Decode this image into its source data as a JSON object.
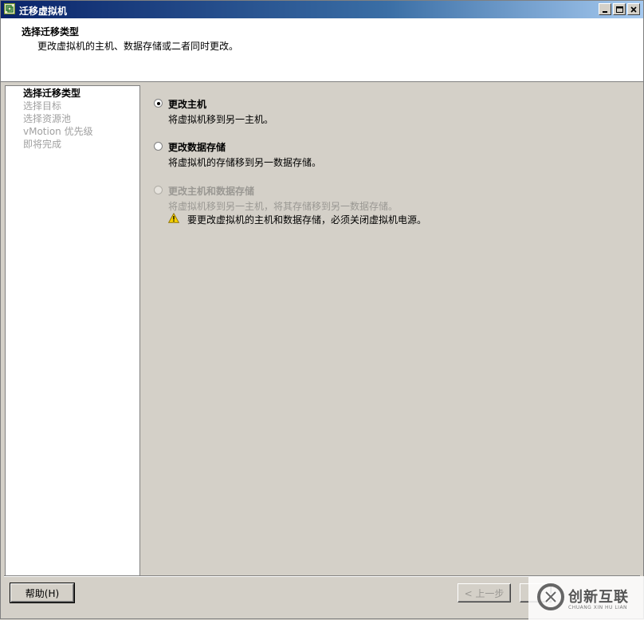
{
  "window": {
    "title": "迁移虚拟机",
    "icon": "vm-migrate-icon"
  },
  "header": {
    "title": "选择迁移类型",
    "subtitle": "更改虚拟机的主机、数据存储或二者同时更改。"
  },
  "steps": [
    {
      "label": "选择迁移类型",
      "active": true
    },
    {
      "label": "选择目标",
      "active": false
    },
    {
      "label": "选择资源池",
      "active": false
    },
    {
      "label": "vMotion 优先级",
      "active": false
    },
    {
      "label": "即将完成",
      "active": false
    }
  ],
  "options": [
    {
      "label": "更改主机",
      "desc": "将虚拟机移到另一主机。",
      "selected": true,
      "enabled": true
    },
    {
      "label": "更改数据存储",
      "desc": "将虚拟机的存储移到另一数据存储。",
      "selected": false,
      "enabled": true
    },
    {
      "label": "更改主机和数据存储",
      "desc": "将虚拟机移到另一主机，将其存储移到另一数据存储。",
      "selected": false,
      "enabled": false,
      "warning": "要更改虚拟机的主机和数据存储，必须关闭虚拟机电源。"
    }
  ],
  "buttons": {
    "help": "帮助(H)",
    "back": "< 上一步"
  },
  "watermark": {
    "cn": "创新互联",
    "en": "CHUANG XIN HU LIAN"
  },
  "colors": {
    "titlebar_start": "#0a246a",
    "dialog_bg": "#d4d0c8",
    "disabled_text": "#9a9893",
    "warning_yellow": "#f5d000"
  }
}
